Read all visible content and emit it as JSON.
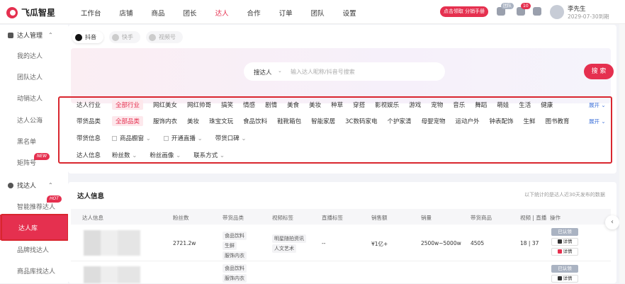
{
  "app": {
    "name": "飞瓜智星"
  },
  "nav": [
    "工作台",
    "店铺",
    "商品",
    "团长",
    "达人",
    "合作",
    "订单",
    "团队",
    "设置"
  ],
  "nav_active": 4,
  "header": {
    "promo": "点击领取 分销手册",
    "badge1": "团队",
    "badge2": "10",
    "user_name": "李先生",
    "expire": "2029-07-30到期"
  },
  "sidebar": {
    "group1": "达人管理",
    "items1": [
      "我的达人",
      "团队达人",
      "动销达人",
      "达人公海",
      "黑名单",
      "矩阵号"
    ],
    "new_badge": "NEW",
    "group2": "找达人",
    "items2": [
      "智能推荐达人",
      "达人库",
      "品牌找达人",
      "商品库找达人"
    ],
    "hot_badge": "HOT"
  },
  "platform_tabs": [
    "抖音",
    "快手",
    "视频号"
  ],
  "search": {
    "type": "搜达人",
    "placeholder": "输入达人昵称/抖音号搜索",
    "button": "搜 索"
  },
  "filters": {
    "row1_label": "达人行业",
    "row1": [
      "全部行业",
      "网红美女",
      "网红帅哥",
      "搞笑",
      "情感",
      "剧情",
      "美食",
      "美妆",
      "种草",
      "穿搭",
      "影视娱乐",
      "游戏",
      "宠物",
      "音乐",
      "舞蹈",
      "萌娃",
      "生活",
      "健康"
    ],
    "row2_label": "带货品类",
    "row2": [
      "全部品类",
      "服饰内衣",
      "美妆",
      "珠宝文玩",
      "食品饮料",
      "鞋靴箱包",
      "智能家居",
      "3C数码家电",
      "个护家清",
      "母婴宠物",
      "运动户外",
      "钟表配饰",
      "生鲜",
      "图书教育"
    ],
    "expand": "展开",
    "row3_label": "带货信息",
    "row3": [
      "商品橱窗",
      "开通直播",
      "带货口碑"
    ],
    "row4_label": "达人信息",
    "row4": [
      "粉丝数",
      "粉丝画像",
      "联系方式"
    ]
  },
  "table": {
    "title": "达人信息",
    "note": "以下统计的是达人近30天发布的数据",
    "headers": [
      "达人信息",
      "粉丝数",
      "带货品类",
      "视频标签",
      "直播标签",
      "销售额",
      "销量",
      "带货商品",
      "视频 | 直播",
      "操作"
    ],
    "rows": [
      {
        "fans": "2721.2w",
        "cats": [
          "食品饮料",
          "生鲜",
          "服饰内衣"
        ],
        "tags": [
          "明星随拍资讯",
          "人文艺术"
        ],
        "live": "--",
        "sales": "¥1亿+",
        "volume": "2500w~5000w",
        "goods": "4505",
        "vl": "18 | 37"
      },
      {
        "fans": "",
        "cats": [
          "食品饮料",
          "服饰内衣"
        ],
        "tags": [],
        "live": "",
        "sales": "",
        "volume": "",
        "goods": "",
        "vl": ""
      }
    ],
    "op_verified": "已认领",
    "op_detail": "详情"
  }
}
